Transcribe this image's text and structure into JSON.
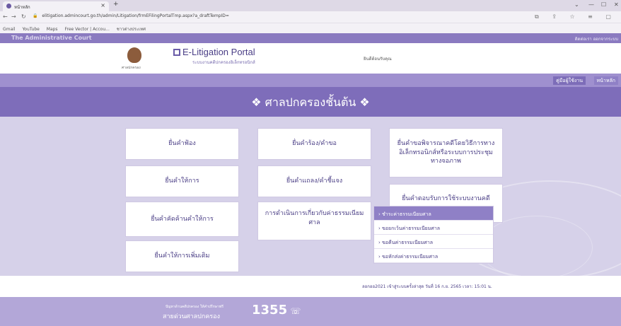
{
  "browser": {
    "tab_title": "หน้าหลัก",
    "tab_close": "×",
    "new_tab": "+",
    "url": "elitigation.admincourt.go.th/admin/Litigation/frmEFilingPortalTmp.aspx?a_draftTempID=",
    "bookmarks": [
      "Gmail",
      "YouTube",
      "Maps",
      "Free Vector | Accou...",
      "ชาวต่างประเทศ"
    ]
  },
  "court_bar": {
    "name": "The Administrative Court",
    "right_links": "ติดต่อเรา   ออกจากระบบ"
  },
  "header": {
    "emblem_caption": "ศาลปกครอง",
    "portal_title": "E-Litigation Portal",
    "portal_subtitle": "ระบบงานคดีปกครองอิเล็กทรอนิกส์",
    "welcome": "ยินดีต้อนรับคุณ"
  },
  "nav": {
    "manual": "คู่มือผู้ใช้งาน",
    "home": "หน้าหลัก"
  },
  "title": "❖ ศาลปกครองชั้นต้น ❖",
  "cards": {
    "c1": "ยื่นคำฟ้อง",
    "c2": "ยื่นคำให้การ",
    "c3": "ยื่นคำคัดค้านคำให้การ",
    "c4": "ยื่นคำให้การเพิ่มเติม",
    "c5": "ยื่นคำร้อง/คำขอ",
    "c6": "ยื่นคำแถลง/คำชี้แจง",
    "c7": "การดำเนินการเกี่ยวกับค่าธรรมเนียมศาล",
    "c8": "ยื่นคำขอพิจารณาคดีโดยวิธีการทางอิเล็กทรอนิกส์หรือระบบการประชุมทางจอภาพ",
    "c9": "ยื่นคำตอบรับการใช้ระบบงานคดี"
  },
  "dropdown": [
    "› ชำระค่าธรรมเนียมศาล",
    "› ขอยกเว้นค่าธรรมเนียมศาล",
    "› ขอคืนค่าธรรมเนียมศาล",
    "› ขอหักส่งค่าธรรมเนียมศาล"
  ],
  "footer_info": "ลอกออ2021 เข้าสู่ระบบครั้งล่าสุด วันที่ 16 ก.ย. 2565 เวลา: 15:01 น.",
  "footer": {
    "small": "ปัญหาด้านคดีปกครอง ให้คำปรึกษาฟรี",
    "hotline_label": "สายด่วนศาลปกครอง",
    "number": "1355"
  }
}
